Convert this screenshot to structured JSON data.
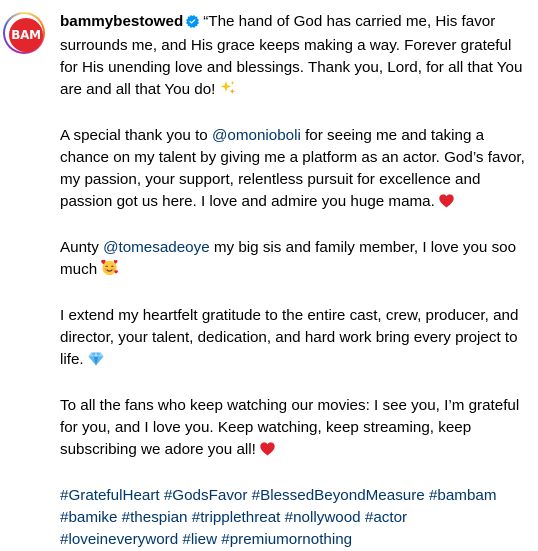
{
  "post": {
    "avatar_text": "BAM",
    "avatar_color": "#e3262b",
    "username": "bammybestowed",
    "verified": true,
    "p1_text": "“The hand of God has carried me, His favor surrounds me, and His grace keeps making a way. Forever grateful for His unending love and blessings. Thank you, Lord, for all that You are and all that You do!",
    "p1_emoji": "sparkles-emoji",
    "p2_before": "A special thank you to ",
    "p2_mention": "@omonioboli",
    "p2_after": " for seeing me and taking a chance on my talent by giving me a platform as an actor. God’s favor, my passion, your support, relentless pursuit for excellence and passion got us here. I love and admire you huge mama.",
    "p2_emoji": "red-heart-emoji",
    "p3_before": "Aunty ",
    "p3_mention": "@tomesadeoye",
    "p3_after": " my big sis and family member, I love you soo much",
    "p3_emoji": "smiling-face-with-hearts-emoji",
    "p4_text": "I extend my heartfelt gratitude to the entire cast, crew, producer, and director, your talent, dedication, and hard work bring every project to life.",
    "p4_emoji": "gem-emoji",
    "p5_text": "To all the fans who keep watching our movies: I see you, I’m grateful for you, and I love you. Keep watching, keep streaming, keep subscribing we adore you all!",
    "p5_emoji": "red-heart-emoji",
    "hashtags": [
      "#GratefulHeart",
      "#GodsFavor",
      "#BlessedBeyondMeasure",
      "#bambam",
      "#bamike",
      "#thespian",
      "#tripplethreat",
      "#nollywood",
      "#actor",
      "#loveineveryword",
      "#liew",
      "#premiumornothing"
    ],
    "link_color": "#00376b",
    "verified_color": "#0095f6"
  }
}
